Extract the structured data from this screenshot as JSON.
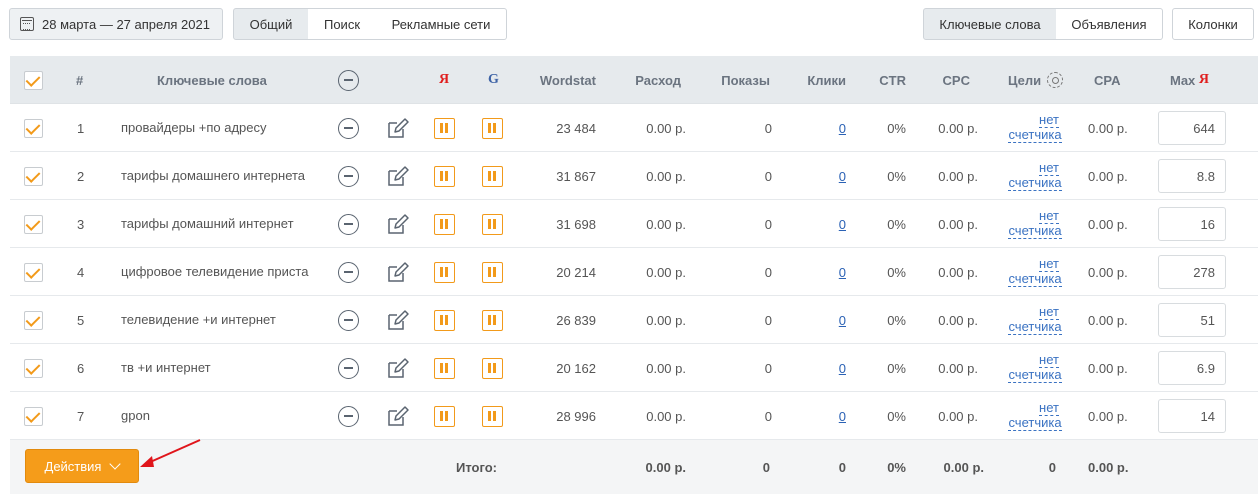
{
  "toolbar": {
    "date_range": "28 марта — 27 апреля 2021",
    "view_tabs": [
      "Общий",
      "Поиск",
      "Рекламные сети"
    ],
    "entity_tabs": [
      "Ключевые слова",
      "Объявления"
    ],
    "columns_label": "Колонки"
  },
  "table": {
    "headers": {
      "num": "#",
      "keywords": "Ключевые слова",
      "yandex": "Я",
      "google": "G",
      "wordstat": "Wordstat",
      "cost": "Расход",
      "impressions": "Показы",
      "clicks": "Клики",
      "ctr": "CTR",
      "cpc": "CPC",
      "goals": "Цели",
      "cpa": "CPA",
      "max": "Max",
      "max_ya": "Я"
    },
    "rows": [
      {
        "num": "1",
        "keyword": "провайдеры +по адресу",
        "wordstat": "23 484",
        "cost": "0.00 р.",
        "impressions": "0",
        "clicks": "0",
        "ctr": "0%",
        "cpc": "0.00 р.",
        "goals_1": "нет",
        "goals_2": "счетчика",
        "cpa": "0.00 р.",
        "max": "644"
      },
      {
        "num": "2",
        "keyword": "тарифы домашнего интернета",
        "wordstat": "31 867",
        "cost": "0.00 р.",
        "impressions": "0",
        "clicks": "0",
        "ctr": "0%",
        "cpc": "0.00 р.",
        "goals_1": "нет",
        "goals_2": "счетчика",
        "cpa": "0.00 р.",
        "max": "8.8"
      },
      {
        "num": "3",
        "keyword": "тарифы домашний интернет",
        "wordstat": "31 698",
        "cost": "0.00 р.",
        "impressions": "0",
        "clicks": "0",
        "ctr": "0%",
        "cpc": "0.00 р.",
        "goals_1": "нет",
        "goals_2": "счетчика",
        "cpa": "0.00 р.",
        "max": "16"
      },
      {
        "num": "4",
        "keyword": "цифровое телевидение пристав",
        "wordstat": "20 214",
        "cost": "0.00 р.",
        "impressions": "0",
        "clicks": "0",
        "ctr": "0%",
        "cpc": "0.00 р.",
        "goals_1": "нет",
        "goals_2": "счетчика",
        "cpa": "0.00 р.",
        "max": "278"
      },
      {
        "num": "5",
        "keyword": "телевидение +и интернет",
        "wordstat": "26 839",
        "cost": "0.00 р.",
        "impressions": "0",
        "clicks": "0",
        "ctr": "0%",
        "cpc": "0.00 р.",
        "goals_1": "нет",
        "goals_2": "счетчика",
        "cpa": "0.00 р.",
        "max": "51"
      },
      {
        "num": "6",
        "keyword": "тв +и интернет",
        "wordstat": "20 162",
        "cost": "0.00 р.",
        "impressions": "0",
        "clicks": "0",
        "ctr": "0%",
        "cpc": "0.00 р.",
        "goals_1": "нет",
        "goals_2": "счетчика",
        "cpa": "0.00 р.",
        "max": "6.9"
      },
      {
        "num": "7",
        "keyword": "gpon",
        "wordstat": "28 996",
        "cost": "0.00 р.",
        "impressions": "0",
        "clicks": "0",
        "ctr": "0%",
        "cpc": "0.00 р.",
        "goals_1": "нет",
        "goals_2": "счетчика",
        "cpa": "0.00 р.",
        "max": "14"
      }
    ],
    "totals": {
      "label": "Итого:",
      "cost": "0.00 р.",
      "impressions": "0",
      "clicks": "0",
      "ctr": "0%",
      "cpc": "0.00 р.",
      "goals": "0",
      "cpa": "0.00 р."
    }
  },
  "footer": {
    "actions_label": "Действия"
  },
  "colors": {
    "accent": "#f59c1a",
    "link": "#2b62b5",
    "yandex_red": "#e01d1d",
    "annotation_arrow": "#e0151b"
  },
  "icons": [
    "calendar-icon",
    "minus-circle-icon",
    "edit-icon",
    "pause-icon",
    "gear-icon",
    "chevron-down-icon",
    "checkbox-checked-icon"
  ]
}
